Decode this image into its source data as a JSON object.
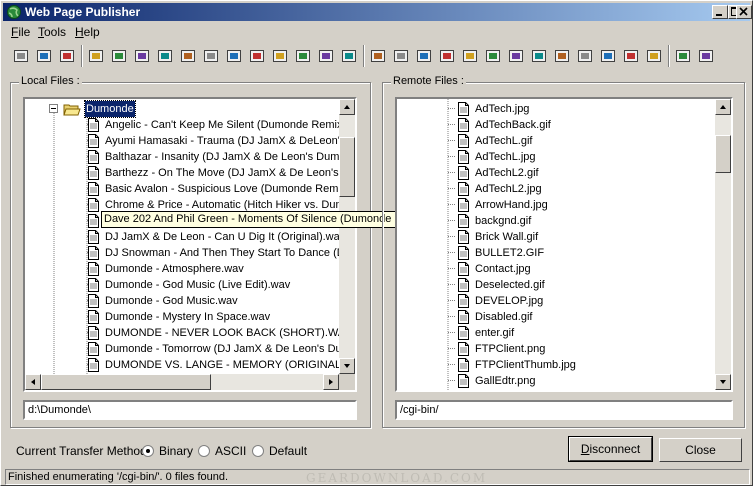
{
  "window": {
    "title": "Web Page Publisher",
    "accent": "#0a246a"
  },
  "menu": [
    {
      "label": "File",
      "underline": "F",
      "rest": "ile"
    },
    {
      "label": "Tools",
      "underline": "T",
      "rest": "ools"
    },
    {
      "label": "Help",
      "underline": "H",
      "rest": "elp"
    }
  ],
  "toolbar_icons": [
    "connect-icon",
    "disconnect-icon",
    "window-icon",
    "open-folder-icon",
    "edit-icon",
    "arrow-icon",
    "properties-icon",
    "settings-icon",
    "copy-pages-icon",
    "recycle-icon",
    "cut-icon",
    "copy-icon",
    "paste-icon",
    "refresh-icon",
    "options-icon",
    "folder-icon",
    "tools-icon",
    "new-folder-icon",
    "diamond-icon",
    "move-icon",
    "drive-icon",
    "network-icon",
    "delete-icon",
    "folder-up-icon",
    "refresh-remote-icon",
    "help-icon",
    "web-icon",
    "settings-remote-icon",
    "book-icon",
    "info-icon"
  ],
  "local": {
    "label": "Local Files :",
    "folder": "Dumonde",
    "files": [
      "Angelic - Can't Keep Me Silent (Dumonde Remix).wav",
      "Ayumi Hamasaki - Trauma (DJ JamX & DeLeon's Dumonde Remix).wav",
      "Balthazar - Insanity (DJ JamX & De Leon's Dumonde Remix).wav",
      "Barthezz - On The Move (DJ JamX & De Leon's Dumonde Remix).wav",
      "Basic Avalon - Suspicious Love (Dumonde Remix).wav",
      "Chrome & Price - Automatic (Hitch Hiker vs. Dumonde Remix).wav",
      "Dave 202 And Phil Green - Moments Of Silence (Dumonde Mix).wav",
      "DJ JamX & De Leon - Can U Dig It (Original).wav",
      "DJ Snowman - And Then They Start To Dance (Dumonde Remix).wav",
      "Dumonde - Atmosphere.wav",
      "Dumonde - God Music (Live Edit).wav",
      "Dumonde - God Music.wav",
      "Dumonde - Mystery In Space.wav",
      "DUMONDE - NEVER LOOK BACK (SHORT).WAV",
      "Dumonde - Tomorrow (DJ JamX & De Leon's Dumonde Remix).wav",
      "DUMONDE VS. LANGE - MEMORY (ORIGINAL VERSION).WAV"
    ],
    "tooltip": "Dave 202 And Phil Green - Moments Of Silence (Dumonde Mix).wav",
    "path": "d:\\Dumonde\\"
  },
  "remote": {
    "label": "Remote Files :",
    "files": [
      "AdTech.jpg",
      "AdTechBack.gif",
      "AdTechL.gif",
      "AdTechL.jpg",
      "AdTechL2.gif",
      "AdTechL2.jpg",
      "ArrowHand.jpg",
      "backgnd.gif",
      "Brick Wall.gif",
      "BULLET2.GIF",
      "Contact.jpg",
      "Deselected.gif",
      "DEVELOP.jpg",
      "Disabled.gif",
      "enter.gif",
      "FTPClient.png",
      "FTPClientThumb.jpg",
      "GallEdtr.png"
    ],
    "path": "/cgi-bin/"
  },
  "transfer": {
    "label": "Current Transfer Method :",
    "options": [
      "Binary",
      "ASCII",
      "Default"
    ],
    "selected": "Binary"
  },
  "buttons": {
    "disconnect": "Disconnect",
    "close": "Close"
  },
  "status": "Finished enumerating '/cgi-bin/'.  0 files found.",
  "watermark": "GEARDOWNLOAD.COM"
}
